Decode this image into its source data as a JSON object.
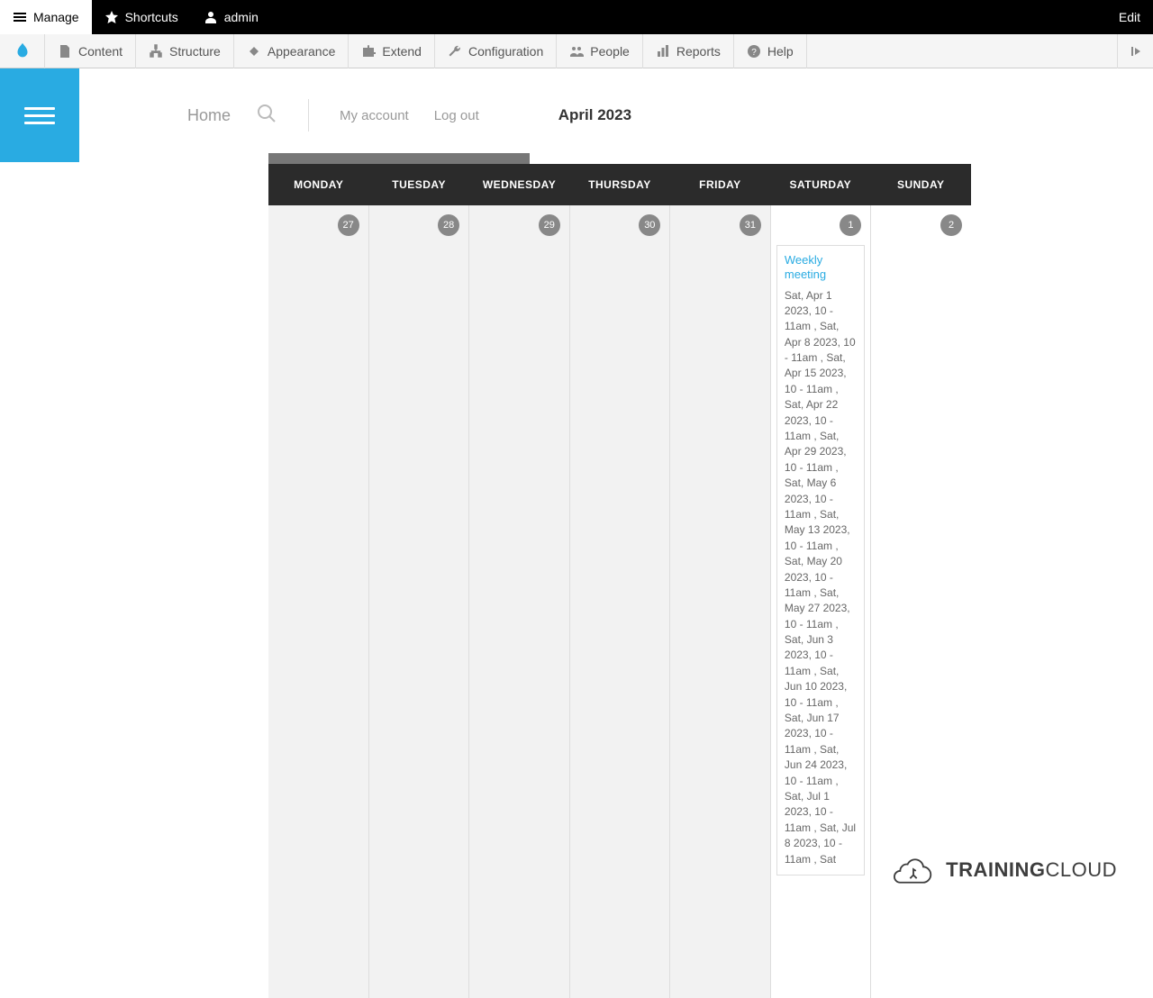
{
  "adminBar": {
    "manage": "Manage",
    "shortcuts": "Shortcuts",
    "user": "admin",
    "edit": "Edit"
  },
  "adminMenu": {
    "content": "Content",
    "structure": "Structure",
    "appearance": "Appearance",
    "extend": "Extend",
    "configuration": "Configuration",
    "people": "People",
    "reports": "Reports",
    "help": "Help"
  },
  "nav": {
    "home": "Home",
    "myAccount": "My account",
    "logOut": "Log out",
    "title": "April 2023"
  },
  "calendar": {
    "days": [
      "MONDAY",
      "TUESDAY",
      "WEDNESDAY",
      "THURSDAY",
      "FRIDAY",
      "SATURDAY",
      "SUNDAY"
    ],
    "cells": [
      {
        "num": "27",
        "other": true
      },
      {
        "num": "28",
        "other": true
      },
      {
        "num": "29",
        "other": true
      },
      {
        "num": "30",
        "other": true
      },
      {
        "num": "31",
        "other": true
      },
      {
        "num": "1",
        "other": false,
        "event": {
          "title": "Weekly meeting",
          "body": "Sat, Apr 1 2023, 10 - 11am , Sat, Apr 8 2023, 10 - 11am , Sat, Apr 15 2023, 10 - 11am , Sat, Apr 22 2023, 10 - 11am , Sat, Apr 29 2023, 10 - 11am , Sat, May 6 2023, 10 - 11am , Sat, May 13 2023, 10 - 11am , Sat, May 20 2023, 10 - 11am , Sat, May 27 2023, 10 - 11am , Sat, Jun 3 2023, 10 - 11am , Sat, Jun 10 2023, 10 - 11am , Sat, Jun 17 2023, 10 - 11am , Sat, Jun 24 2023, 10 - 11am , Sat, Jul 1 2023, 10 - 11am , Sat, Jul 8 2023, 10 - 11am , Sat"
        }
      },
      {
        "num": "2",
        "other": false
      }
    ]
  },
  "watermark": {
    "brand1": "TRAINING",
    "brand2": "CLOUD"
  }
}
